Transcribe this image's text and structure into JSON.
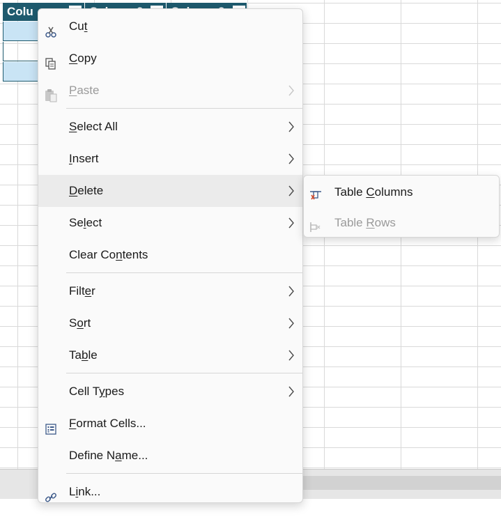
{
  "sheet": {
    "columns": [
      "Colu",
      "Column 2",
      "Column 3"
    ]
  },
  "context_menu": {
    "items": [
      {
        "pre": "Cu",
        "key": "t",
        "post": "",
        "icon": "scissors-icon",
        "submenu": false,
        "disabled": false
      },
      {
        "pre": "",
        "key": "C",
        "post": "opy",
        "icon": "copy-icon",
        "submenu": false,
        "disabled": false
      },
      {
        "pre": "",
        "key": "P",
        "post": "aste",
        "icon": "paste-icon",
        "submenu": true,
        "disabled": true
      },
      {
        "pre": "",
        "key": "S",
        "post": "elect All",
        "icon": "",
        "submenu": true,
        "disabled": false
      },
      {
        "pre": "",
        "key": "I",
        "post": "nsert",
        "icon": "",
        "submenu": true,
        "disabled": false
      },
      {
        "pre": "",
        "key": "D",
        "post": "elete",
        "icon": "",
        "submenu": true,
        "disabled": false,
        "highlighted": true
      },
      {
        "pre": "Se",
        "key": "l",
        "post": "ect",
        "icon": "",
        "submenu": true,
        "disabled": false
      },
      {
        "pre": "Clear Co",
        "key": "n",
        "post": "tents",
        "icon": "",
        "submenu": false,
        "disabled": false
      },
      {
        "pre": "Filt",
        "key": "e",
        "post": "r",
        "icon": "",
        "submenu": true,
        "disabled": false
      },
      {
        "pre": "S",
        "key": "o",
        "post": "rt",
        "icon": "",
        "submenu": true,
        "disabled": false
      },
      {
        "pre": "Ta",
        "key": "b",
        "post": "le",
        "icon": "",
        "submenu": true,
        "disabled": false
      },
      {
        "pre": "Cell T",
        "key": "y",
        "post": "pes",
        "icon": "",
        "submenu": true,
        "disabled": false
      },
      {
        "pre": "",
        "key": "F",
        "post": "ormat Cells...",
        "icon": "format-cells-icon",
        "submenu": false,
        "disabled": false
      },
      {
        "pre": "Define N",
        "key": "a",
        "post": "me...",
        "icon": "",
        "submenu": false,
        "disabled": false
      },
      {
        "pre": "L",
        "key": "i",
        "post": "nk...",
        "icon": "link-icon",
        "submenu": false,
        "disabled": false
      }
    ]
  },
  "delete_submenu": {
    "items": [
      {
        "pre": "Table ",
        "key": "C",
        "post": "olumns",
        "icon": "delete-table-columns-icon",
        "disabled": false
      },
      {
        "pre": "Table ",
        "key": "R",
        "post": "ows",
        "icon": "delete-table-rows-icon",
        "disabled": true
      }
    ]
  },
  "colors": {
    "table_header": "#1e5a6e",
    "band": "#c9e4f5",
    "menu_bg": "#fafafa",
    "highlight": "#ebebeb"
  }
}
